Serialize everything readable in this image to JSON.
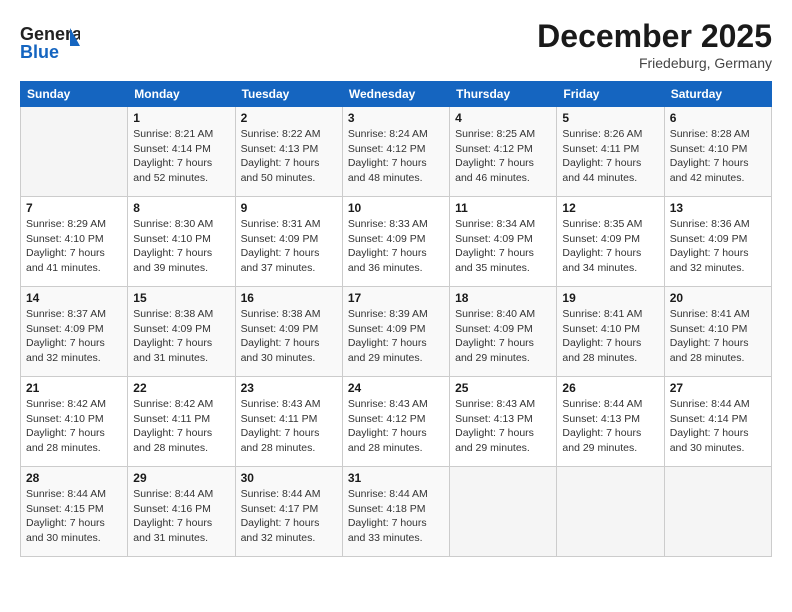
{
  "header": {
    "logo_line1": "General",
    "logo_line2": "Blue",
    "month": "December 2025",
    "location": "Friedeburg, Germany"
  },
  "weekdays": [
    "Sunday",
    "Monday",
    "Tuesday",
    "Wednesday",
    "Thursday",
    "Friday",
    "Saturday"
  ],
  "weeks": [
    [
      {
        "day": "",
        "info": ""
      },
      {
        "day": "1",
        "info": "Sunrise: 8:21 AM\nSunset: 4:14 PM\nDaylight: 7 hours\nand 52 minutes."
      },
      {
        "day": "2",
        "info": "Sunrise: 8:22 AM\nSunset: 4:13 PM\nDaylight: 7 hours\nand 50 minutes."
      },
      {
        "day": "3",
        "info": "Sunrise: 8:24 AM\nSunset: 4:12 PM\nDaylight: 7 hours\nand 48 minutes."
      },
      {
        "day": "4",
        "info": "Sunrise: 8:25 AM\nSunset: 4:12 PM\nDaylight: 7 hours\nand 46 minutes."
      },
      {
        "day": "5",
        "info": "Sunrise: 8:26 AM\nSunset: 4:11 PM\nDaylight: 7 hours\nand 44 minutes."
      },
      {
        "day": "6",
        "info": "Sunrise: 8:28 AM\nSunset: 4:10 PM\nDaylight: 7 hours\nand 42 minutes."
      }
    ],
    [
      {
        "day": "7",
        "info": "Sunrise: 8:29 AM\nSunset: 4:10 PM\nDaylight: 7 hours\nand 41 minutes."
      },
      {
        "day": "8",
        "info": "Sunrise: 8:30 AM\nSunset: 4:10 PM\nDaylight: 7 hours\nand 39 minutes."
      },
      {
        "day": "9",
        "info": "Sunrise: 8:31 AM\nSunset: 4:09 PM\nDaylight: 7 hours\nand 37 minutes."
      },
      {
        "day": "10",
        "info": "Sunrise: 8:33 AM\nSunset: 4:09 PM\nDaylight: 7 hours\nand 36 minutes."
      },
      {
        "day": "11",
        "info": "Sunrise: 8:34 AM\nSunset: 4:09 PM\nDaylight: 7 hours\nand 35 minutes."
      },
      {
        "day": "12",
        "info": "Sunrise: 8:35 AM\nSunset: 4:09 PM\nDaylight: 7 hours\nand 34 minutes."
      },
      {
        "day": "13",
        "info": "Sunrise: 8:36 AM\nSunset: 4:09 PM\nDaylight: 7 hours\nand 32 minutes."
      }
    ],
    [
      {
        "day": "14",
        "info": "Sunrise: 8:37 AM\nSunset: 4:09 PM\nDaylight: 7 hours\nand 32 minutes."
      },
      {
        "day": "15",
        "info": "Sunrise: 8:38 AM\nSunset: 4:09 PM\nDaylight: 7 hours\nand 31 minutes."
      },
      {
        "day": "16",
        "info": "Sunrise: 8:38 AM\nSunset: 4:09 PM\nDaylight: 7 hours\nand 30 minutes."
      },
      {
        "day": "17",
        "info": "Sunrise: 8:39 AM\nSunset: 4:09 PM\nDaylight: 7 hours\nand 29 minutes."
      },
      {
        "day": "18",
        "info": "Sunrise: 8:40 AM\nSunset: 4:09 PM\nDaylight: 7 hours\nand 29 minutes."
      },
      {
        "day": "19",
        "info": "Sunrise: 8:41 AM\nSunset: 4:10 PM\nDaylight: 7 hours\nand 28 minutes."
      },
      {
        "day": "20",
        "info": "Sunrise: 8:41 AM\nSunset: 4:10 PM\nDaylight: 7 hours\nand 28 minutes."
      }
    ],
    [
      {
        "day": "21",
        "info": "Sunrise: 8:42 AM\nSunset: 4:10 PM\nDaylight: 7 hours\nand 28 minutes."
      },
      {
        "day": "22",
        "info": "Sunrise: 8:42 AM\nSunset: 4:11 PM\nDaylight: 7 hours\nand 28 minutes."
      },
      {
        "day": "23",
        "info": "Sunrise: 8:43 AM\nSunset: 4:11 PM\nDaylight: 7 hours\nand 28 minutes."
      },
      {
        "day": "24",
        "info": "Sunrise: 8:43 AM\nSunset: 4:12 PM\nDaylight: 7 hours\nand 28 minutes."
      },
      {
        "day": "25",
        "info": "Sunrise: 8:43 AM\nSunset: 4:13 PM\nDaylight: 7 hours\nand 29 minutes."
      },
      {
        "day": "26",
        "info": "Sunrise: 8:44 AM\nSunset: 4:13 PM\nDaylight: 7 hours\nand 29 minutes."
      },
      {
        "day": "27",
        "info": "Sunrise: 8:44 AM\nSunset: 4:14 PM\nDaylight: 7 hours\nand 30 minutes."
      }
    ],
    [
      {
        "day": "28",
        "info": "Sunrise: 8:44 AM\nSunset: 4:15 PM\nDaylight: 7 hours\nand 30 minutes."
      },
      {
        "day": "29",
        "info": "Sunrise: 8:44 AM\nSunset: 4:16 PM\nDaylight: 7 hours\nand 31 minutes."
      },
      {
        "day": "30",
        "info": "Sunrise: 8:44 AM\nSunset: 4:17 PM\nDaylight: 7 hours\nand 32 minutes."
      },
      {
        "day": "31",
        "info": "Sunrise: 8:44 AM\nSunset: 4:18 PM\nDaylight: 7 hours\nand 33 minutes."
      },
      {
        "day": "",
        "info": ""
      },
      {
        "day": "",
        "info": ""
      },
      {
        "day": "",
        "info": ""
      }
    ]
  ]
}
